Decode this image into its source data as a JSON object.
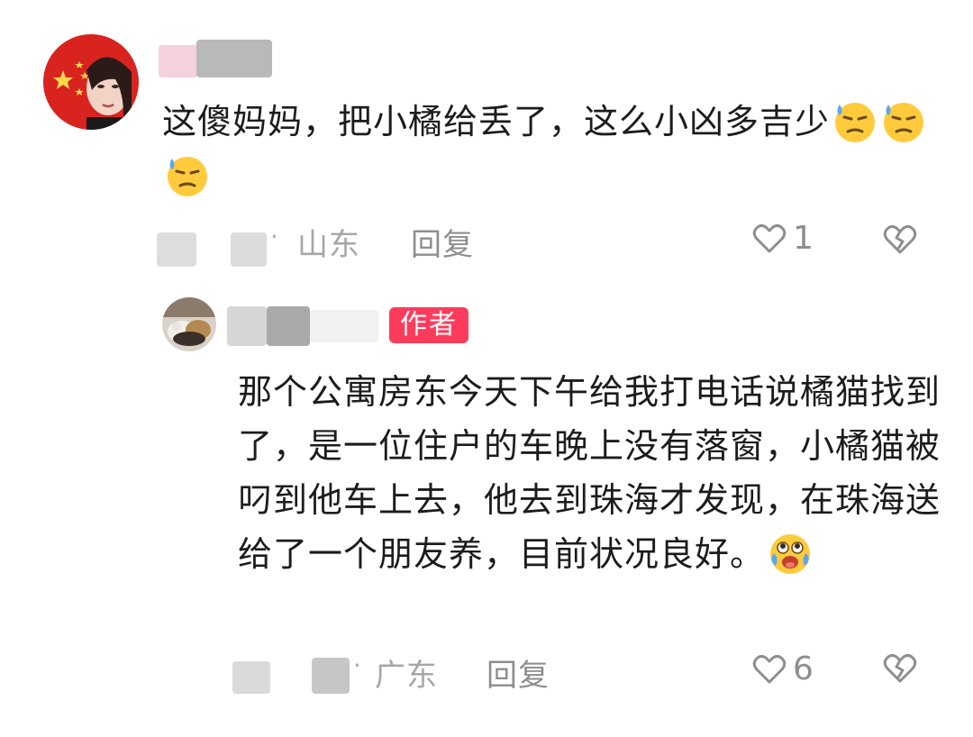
{
  "comments": [
    {
      "avatar_icon": "avatar-flag-icon",
      "text": "这傻妈妈，把小橘给丢了，这么小凶多吉少",
      "emojis": [
        "sweat-emoji",
        "sweat-emoji",
        "sweat-emoji"
      ],
      "location": "山东",
      "dot": "·",
      "reply_label": "回复",
      "likes": "1"
    }
  ],
  "reply": {
    "avatar_icon": "avatar-cat-icon",
    "badge": "作者",
    "text": "那个公寓房东今天下午给我打电话说橘猫找到了，是一位住户的车晚上没有落窗，小橘猫被叼到他车上去，他去到珠海才发现，在珠海送给了一个朋友养，目前状况良好。",
    "emojis": [
      "happy-tears-emoji"
    ],
    "location": "广东",
    "dot": "·",
    "reply_label": "回复",
    "likes": "6"
  },
  "colors": {
    "badge": "#ff3b5c",
    "meta_text": "#a6a6a6",
    "icon": "#8e8e8e"
  }
}
